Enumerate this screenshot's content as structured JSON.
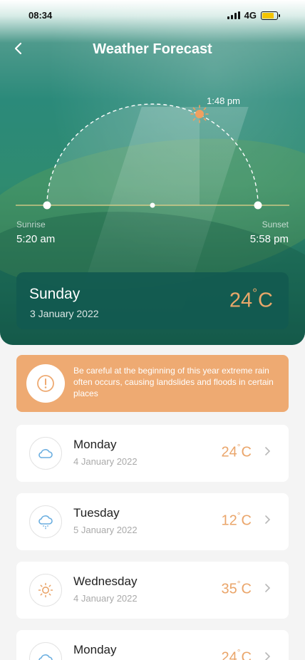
{
  "status_bar": {
    "time": "08:34",
    "network": "4G"
  },
  "header": {
    "title": "Weather Forecast",
    "back_icon": "chevron-left-icon"
  },
  "sun_arc": {
    "current_time": "1:48 pm",
    "sunrise_label": "Sunrise",
    "sunrise_time": "5:20 am",
    "sunset_label": "Sunset",
    "sunset_time": "5:58 pm",
    "sun_icon": "sun-icon",
    "sun_color": "#f0a060"
  },
  "today": {
    "day": "Sunday",
    "date": "3 January 2022",
    "temp_value": "24",
    "temp_unit": "C"
  },
  "alert": {
    "icon": "alert-circle-icon",
    "message": "Be careful at the beginning of this year extreme rain often occurs, causing landslides and floods in certain places",
    "color": "#eeaa72"
  },
  "forecast": [
    {
      "day": "Monday",
      "date": "4 January 2022",
      "temp_value": "24",
      "temp_unit": "C",
      "icon": "cloud-icon"
    },
    {
      "day": "Tuesday",
      "date": "5 January 2022",
      "temp_value": "12",
      "temp_unit": "C",
      "icon": "rain-cloud-icon"
    },
    {
      "day": "Wednesday",
      "date": "4 January 2022",
      "temp_value": "35",
      "temp_unit": "C",
      "icon": "sun-icon"
    },
    {
      "day": "Monday",
      "date": "",
      "temp_value": "24",
      "temp_unit": "C",
      "icon": "cloud-icon"
    }
  ]
}
